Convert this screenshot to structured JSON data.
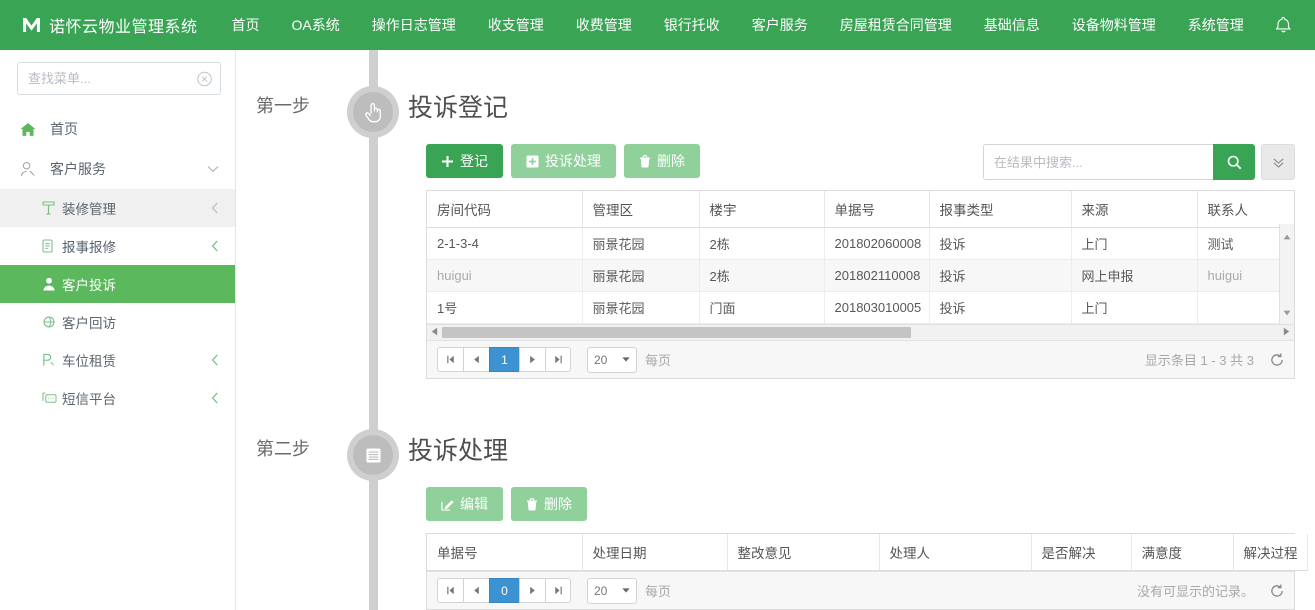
{
  "topnav": {
    "brand": "诺怀云物业管理系统",
    "brand_logo_icon": "m-logo-icon",
    "items": [
      {
        "label": "首页"
      },
      {
        "label": "OA系统"
      },
      {
        "label": "操作日志管理"
      },
      {
        "label": "收支管理"
      },
      {
        "label": "收费管理"
      },
      {
        "label": "银行托收"
      },
      {
        "label": "客户服务"
      },
      {
        "label": "房屋租赁合同管理"
      },
      {
        "label": "基础信息"
      },
      {
        "label": "设备物料管理"
      },
      {
        "label": "系统管理"
      }
    ],
    "bell_icon": "bell-icon",
    "user_icon": "user-icon"
  },
  "sidebar": {
    "search": {
      "placeholder": "查找菜单...",
      "value": "",
      "clear_icon": "clear-circle-icon"
    },
    "items": [
      {
        "label": "首页",
        "icon": "home-icon",
        "level": 0,
        "state": "normal",
        "arrow": ""
      },
      {
        "label": "客户服务",
        "icon": "user-outline-icon",
        "level": 0,
        "state": "normal",
        "arrow": "chevron-down-icon"
      },
      {
        "label": "装修管理",
        "icon": "decoration-icon",
        "level": 1,
        "state": "hovered",
        "arrow": "chevron-left-icon"
      },
      {
        "label": "报事报修",
        "icon": "report-icon",
        "level": 1,
        "state": "normal",
        "arrow": "chevron-left-icon"
      },
      {
        "label": "客户投诉",
        "icon": "complaint-icon",
        "level": 1,
        "state": "active",
        "arrow": ""
      },
      {
        "label": "客户回访",
        "icon": "revisit-icon",
        "level": 1,
        "state": "normal",
        "arrow": ""
      },
      {
        "label": "车位租赁",
        "icon": "parking-icon",
        "level": 1,
        "state": "normal",
        "arrow": "chevron-left-icon"
      },
      {
        "label": "短信平台",
        "icon": "sms-icon",
        "level": 1,
        "state": "normal",
        "arrow": "chevron-left-icon"
      }
    ]
  },
  "steps": [
    {
      "step_label": "第一步",
      "title": "投诉登记",
      "dot_icon": "hand-pointer-icon",
      "buttons": [
        {
          "label": "登记",
          "icon": "plus-icon",
          "style": "primary"
        },
        {
          "label": "投诉处理",
          "icon": "plus-square-icon",
          "style": "muted"
        },
        {
          "label": "删除",
          "icon": "trash-icon",
          "style": "muted"
        }
      ],
      "search": {
        "placeholder": "在结果中搜索...",
        "value": "",
        "search_icon": "search-icon",
        "more_icon": "chevron-double-down-icon"
      },
      "table": {
        "columns": [
          "房间代码",
          "管理区",
          "楼宇",
          "单据号",
          "报事类型",
          "来源",
          "联系人"
        ],
        "rows": [
          [
            "2-1-3-4",
            "丽景花园",
            "2栋",
            "201802060008",
            "投诉",
            "上门",
            "测试"
          ],
          [
            "huigui",
            "丽景花园",
            "2栋",
            "201802110008",
            "投诉",
            "网上申报",
            "huigui"
          ],
          [
            "1号",
            "丽景花园",
            "门面",
            "201803010005",
            "投诉",
            "上门",
            ""
          ]
        ],
        "dim_cells": [
          [
            1,
            0
          ],
          [
            1,
            6
          ]
        ],
        "has_hscroll": true,
        "has_vscroll": true
      },
      "pager": {
        "first_icon": "first-page-icon",
        "prev_icon": "prev-page-icon",
        "current": "1",
        "next_icon": "next-page-icon",
        "last_icon": "last-page-icon",
        "page_size": "20",
        "per_page_label": "每页",
        "status": "显示条目 1 - 3 共 3",
        "refresh_icon": "refresh-icon"
      }
    },
    {
      "step_label": "第二步",
      "title": "投诉处理",
      "dot_icon": "list-lines-icon",
      "buttons": [
        {
          "label": "编辑",
          "icon": "edit-icon",
          "style": "muted"
        },
        {
          "label": "删除",
          "icon": "trash-icon",
          "style": "muted"
        }
      ],
      "table": {
        "columns": [
          "单据号",
          "处理日期",
          "整改意见",
          "处理人",
          "是否解决",
          "满意度",
          "解决过程"
        ],
        "rows": [],
        "has_hscroll": false,
        "has_vscroll": false
      },
      "pager": {
        "first_icon": "first-page-icon",
        "prev_icon": "prev-page-icon",
        "current": "0",
        "next_icon": "next-page-icon",
        "last_icon": "last-page-icon",
        "page_size": "20",
        "per_page_label": "每页",
        "status": "没有可显示的记录。",
        "refresh_icon": "refresh-icon"
      }
    }
  ],
  "colors": {
    "nav_green": "#3aa455",
    "active_green": "#5cb85c",
    "muted_green": "#8fd09b",
    "pager_blue": "#3d92d1",
    "rail_gray": "#cfcfcf"
  }
}
